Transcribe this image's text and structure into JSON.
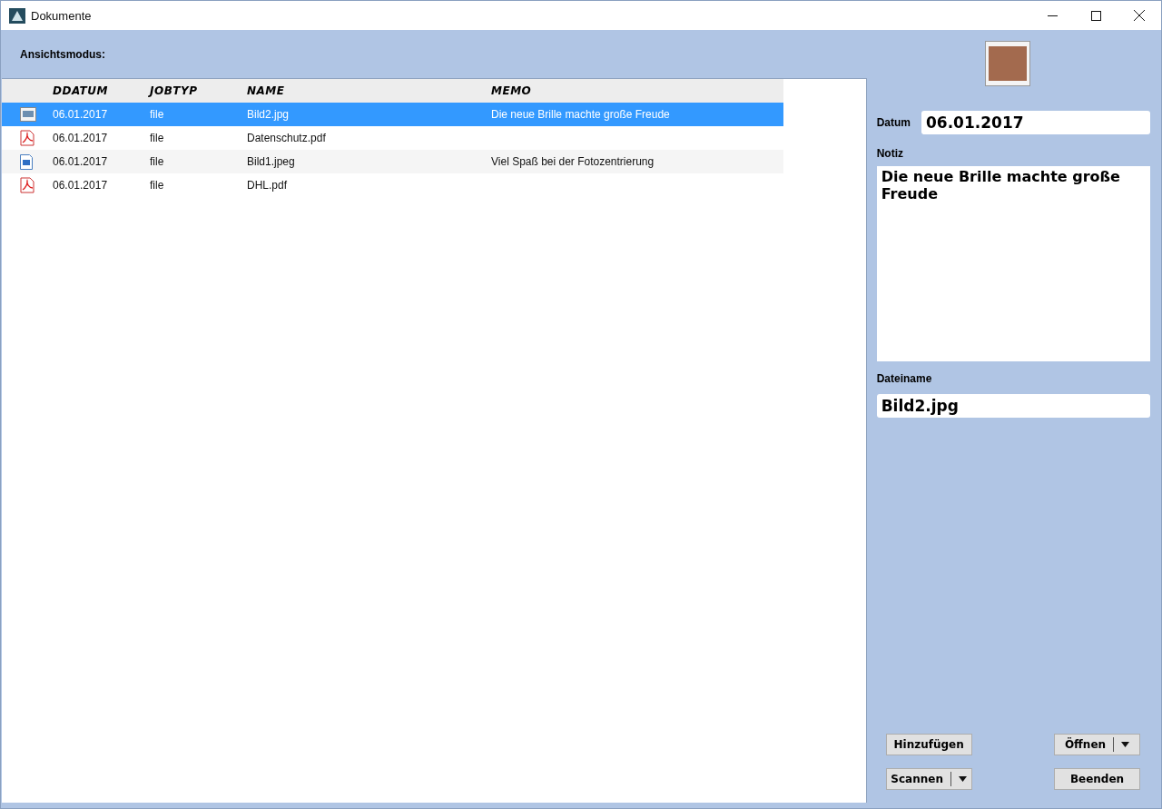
{
  "window": {
    "title": "Dokumente"
  },
  "view_mode_label": "Ansichtsmodus:",
  "table": {
    "columns": [
      "DDATUM",
      "JOBTYP",
      "NAME",
      "MEMO"
    ],
    "rows": [
      {
        "kind": "picture",
        "selected": true,
        "cells": [
          "06.01.2017",
          "file",
          "Bild2.jpg",
          "Die neue Brille machte große Freude"
        ]
      },
      {
        "kind": "pdf",
        "selected": false,
        "cells": [
          "06.01.2017",
          "file",
          "Datenschutz.pdf"
        ]
      },
      {
        "kind": "image",
        "selected": false,
        "cells": [
          "06.01.2017",
          "file",
          "Bild1.jpeg",
          "Viel Spaß bei der Fotozentrierung"
        ]
      },
      {
        "kind": "pdf",
        "selected": false,
        "cells": [
          "06.01.2017",
          "file",
          "DHL.pdf"
        ]
      }
    ]
  },
  "details": {
    "date_label": "Datum",
    "date": "06.01.2017",
    "note_label": "Notiz",
    "note": "Die neue Brille machte große Freude",
    "filename_label": "Dateiname",
    "filename": "Bild2.jpg"
  },
  "buttons": [
    {
      "label": "Hinzufügen",
      "kind": "plain"
    },
    {
      "label": "Öffnen",
      "kind": "split"
    },
    {
      "label": "Scannen",
      "kind": "split"
    },
    {
      "label": "Beenden",
      "kind": "plain"
    }
  ]
}
